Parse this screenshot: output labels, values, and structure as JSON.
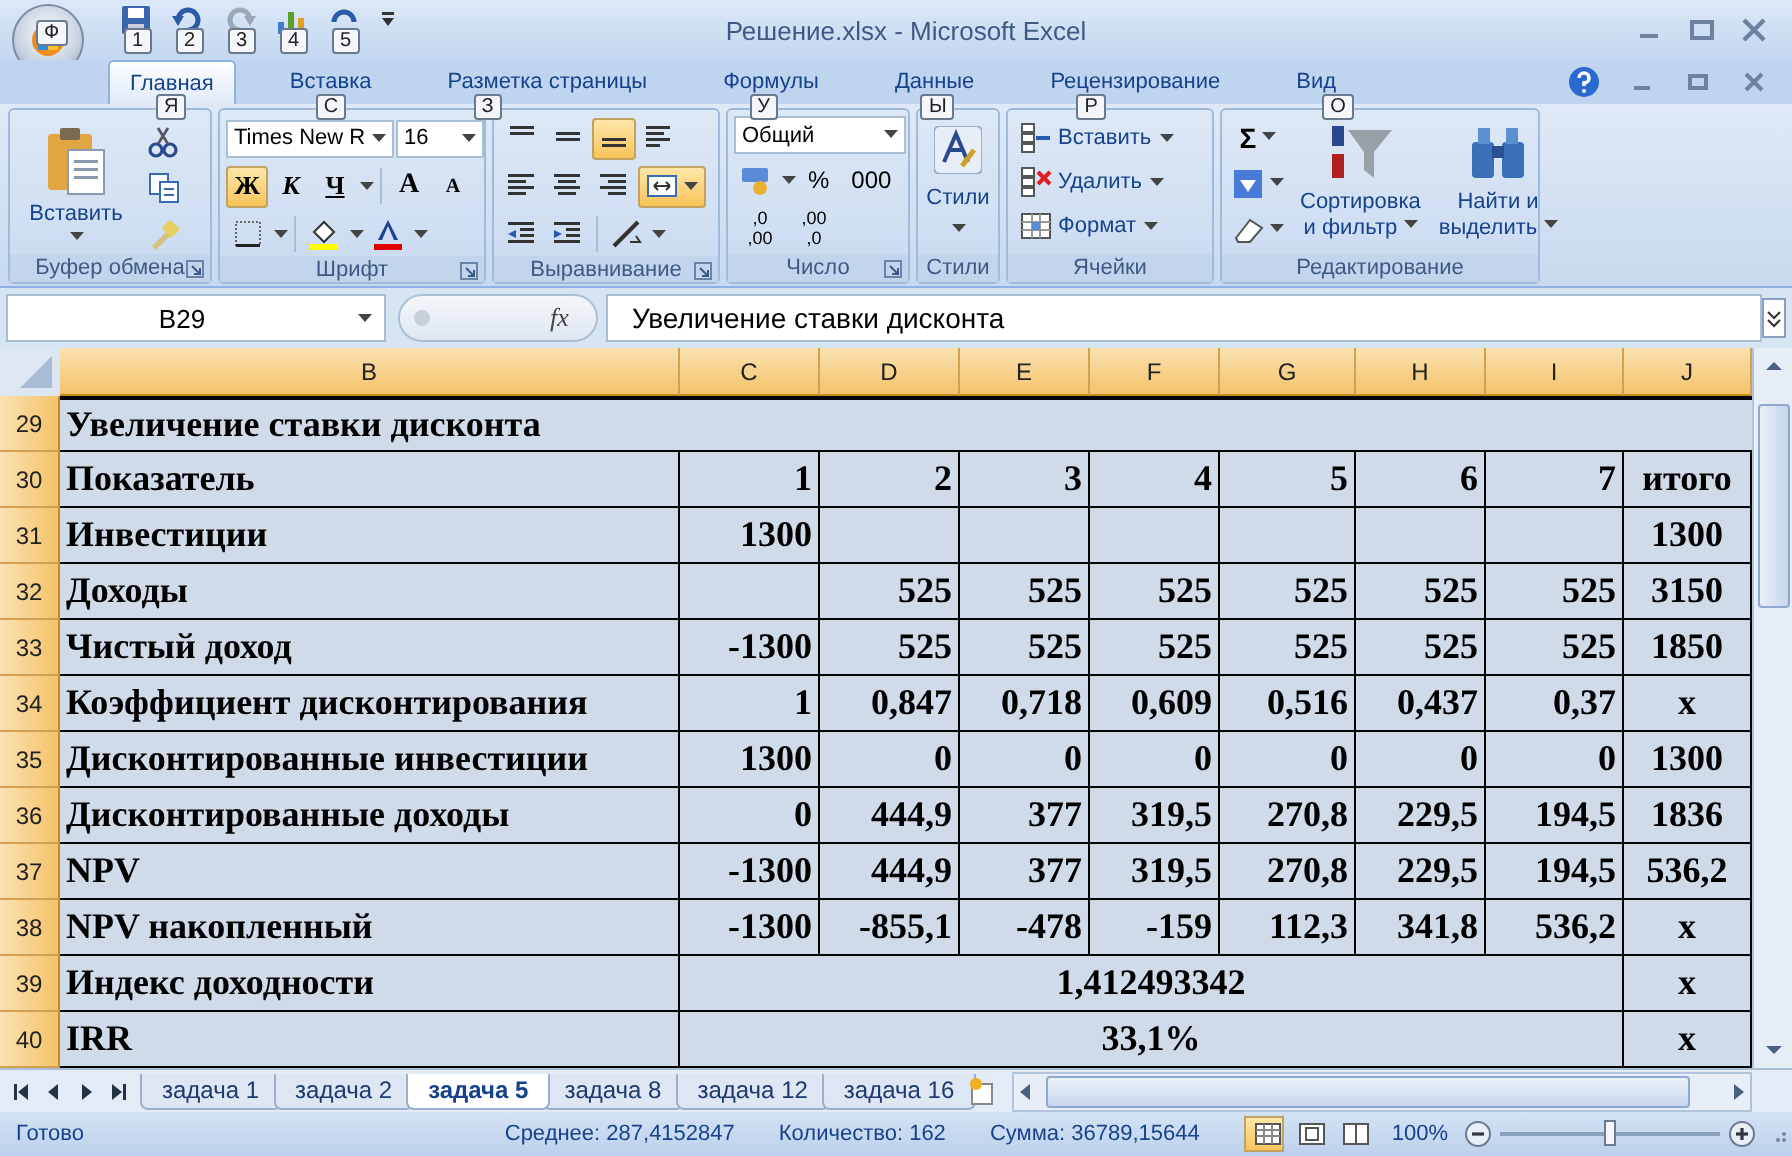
{
  "window": {
    "title": "Решение.xlsx - Microsoft Excel",
    "office_keytip": "Ф",
    "quick_access_keytips": [
      "1",
      "2",
      "3",
      "4",
      "5"
    ]
  },
  "ribbon_tabs": [
    {
      "label": "Главная",
      "selected": true,
      "keytip": "Я"
    },
    {
      "label": "Вставка",
      "selected": false,
      "keytip": "С"
    },
    {
      "label": "Разметка страницы",
      "selected": false,
      "keytip": "З"
    },
    {
      "label": "Формулы",
      "selected": false,
      "keytip": "У"
    },
    {
      "label": "Данные",
      "selected": false,
      "keytip": "Ы"
    },
    {
      "label": "Рецензирование",
      "selected": false,
      "keytip": "Р"
    },
    {
      "label": "Вид",
      "selected": false,
      "keytip": "О"
    }
  ],
  "ribbon": {
    "groups": [
      {
        "kind": "clipboard",
        "label": "Буфер обмена",
        "paste": "Вставить"
      },
      {
        "kind": "font",
        "label": "Шрифт",
        "font": "Times New R",
        "size": "16",
        "bold": {
          "text": "Ж",
          "on": true
        },
        "italic": {
          "text": "К",
          "on": false
        },
        "underline": {
          "text": "Ч",
          "on": false
        },
        "grow": "A",
        "shrink": "A"
      },
      {
        "kind": "alignment",
        "label": "Выравнивание",
        "bottom_align_on": true,
        "merge_on": true
      },
      {
        "kind": "number",
        "label": "Число",
        "format": "Общий",
        "percent": "%",
        "thousands": "000",
        "increase_decimal": [
          ",0",
          ",00"
        ],
        "decrease_decimal": [
          ",00",
          ",0"
        ]
      },
      {
        "kind": "styles",
        "label": "Стили",
        "button": "Стили"
      },
      {
        "kind": "cells",
        "label": "Ячейки",
        "items": [
          "Вставить",
          "Удалить",
          "Формат"
        ]
      },
      {
        "kind": "editing",
        "label": "Редактирование",
        "sum": "Σ",
        "sort": [
          "Сортировка",
          "и фильтр"
        ],
        "find": [
          "Найти и",
          "выделить"
        ]
      }
    ]
  },
  "formula_bar": {
    "name_box": "B29",
    "fx": "fx",
    "value": "Увеличение ставки дисконта"
  },
  "sheet": {
    "columns": [
      "B",
      "C",
      "D",
      "E",
      "F",
      "G",
      "H",
      "I",
      "J"
    ],
    "rows": [
      {
        "kind": "title",
        "number": "29",
        "label": "Увеличение ставки дисконта"
      },
      {
        "kind": "data",
        "number": "30",
        "label": "Показатель",
        "cells": [
          "1",
          "2",
          "3",
          "4",
          "5",
          "6",
          "7",
          "итого"
        ]
      },
      {
        "kind": "data",
        "number": "31",
        "label": "Инвестиции",
        "cells": [
          "1300",
          "",
          "",
          "",
          "",
          "",
          "",
          "1300"
        ]
      },
      {
        "kind": "data",
        "number": "32",
        "label": "Доходы",
        "cells": [
          "",
          "525",
          "525",
          "525",
          "525",
          "525",
          "525",
          "3150"
        ]
      },
      {
        "kind": "data",
        "number": "33",
        "label": "Чистый доход",
        "cells": [
          "-1300",
          "525",
          "525",
          "525",
          "525",
          "525",
          "525",
          "1850"
        ]
      },
      {
        "kind": "data",
        "number": "34",
        "label": "Коэффициент дисконтирования",
        "cells": [
          "1",
          "0,847",
          "0,718",
          "0,609",
          "0,516",
          "0,437",
          "0,37",
          "x"
        ]
      },
      {
        "kind": "data",
        "number": "35",
        "label": "Дисконтированные инвестиции",
        "cells": [
          "1300",
          "0",
          "0",
          "0",
          "0",
          "0",
          "0",
          "1300"
        ]
      },
      {
        "kind": "data",
        "number": "36",
        "label": "Дисконтированные доходы",
        "cells": [
          "0",
          "444,9",
          "377",
          "319,5",
          "270,8",
          "229,5",
          "194,5",
          "1836"
        ]
      },
      {
        "kind": "data",
        "number": "37",
        "label": "NPV",
        "cells": [
          "-1300",
          "444,9",
          "377",
          "319,5",
          "270,8",
          "229,5",
          "194,5",
          "536,2"
        ]
      },
      {
        "kind": "data",
        "number": "38",
        "label": "NPV накопленный",
        "cells": [
          "-1300",
          "-855,1",
          "-478",
          "-159",
          "112,3",
          "341,8",
          "536,2",
          "x"
        ]
      },
      {
        "kind": "merged",
        "number": "39",
        "label": "Индекс доходности",
        "value": "1,412493342",
        "last": "x"
      },
      {
        "kind": "merged",
        "number": "40",
        "label": "IRR",
        "value": "33,1%",
        "last": "x"
      }
    ]
  },
  "sheet_tabs": [
    {
      "label": "задача 1",
      "selected": false
    },
    {
      "label": "задача 2",
      "selected": false
    },
    {
      "label": "задача 5",
      "selected": true
    },
    {
      "label": "задача 8",
      "selected": false
    },
    {
      "label": "задача 12",
      "selected": false
    },
    {
      "label": "задача 16",
      "selected": false
    }
  ],
  "status_bar": {
    "state": "Готово",
    "average": "Среднее: 287,4152847",
    "count": "Количество: 162",
    "sum": "Сумма: 36789,15644",
    "views": [
      {
        "kind": "normal",
        "selected": true
      },
      {
        "kind": "layout",
        "selected": false
      },
      {
        "kind": "pagebreak",
        "selected": false
      }
    ],
    "zoom": "100%",
    "zoom_slider": {
      "level": 0.5
    }
  }
}
